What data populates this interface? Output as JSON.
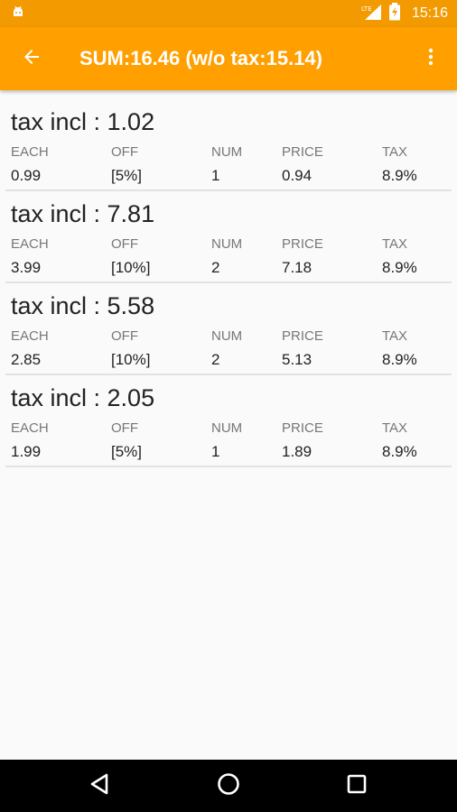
{
  "status_bar": {
    "time": "15:16",
    "network_label": "LTE",
    "icons": [
      "android-icon",
      "signal-icon",
      "battery-icon"
    ]
  },
  "app_bar": {
    "title": "SUM:16.46 (w/o tax:15.14)",
    "back_icon": "arrow-left-icon",
    "menu_icon": "more-vert-icon"
  },
  "columns": [
    "EACH",
    "OFF",
    "NUM",
    "PRICE",
    "TAX"
  ],
  "items": [
    {
      "title": "tax incl : 1.02",
      "each": "0.99",
      "off": "[5%]",
      "num": "1",
      "price": "0.94",
      "tax": "8.9%"
    },
    {
      "title": "tax incl : 7.81",
      "each": "3.99",
      "off": "[10%]",
      "num": "2",
      "price": "7.18",
      "tax": "8.9%"
    },
    {
      "title": "tax incl : 5.58",
      "each": "2.85",
      "off": "[10%]",
      "num": "2",
      "price": "5.13",
      "tax": "8.9%"
    },
    {
      "title": "tax incl : 2.05",
      "each": "1.99",
      "off": "[5%]",
      "num": "1",
      "price": "1.89",
      "tax": "8.9%"
    }
  ],
  "nav_bar": {
    "icons": [
      "nav-back-icon",
      "nav-home-icon",
      "nav-recents-icon"
    ]
  },
  "colors": {
    "app_bar": "#ff9f00",
    "status_bar": "#f29a00",
    "background": "#fafafa"
  }
}
